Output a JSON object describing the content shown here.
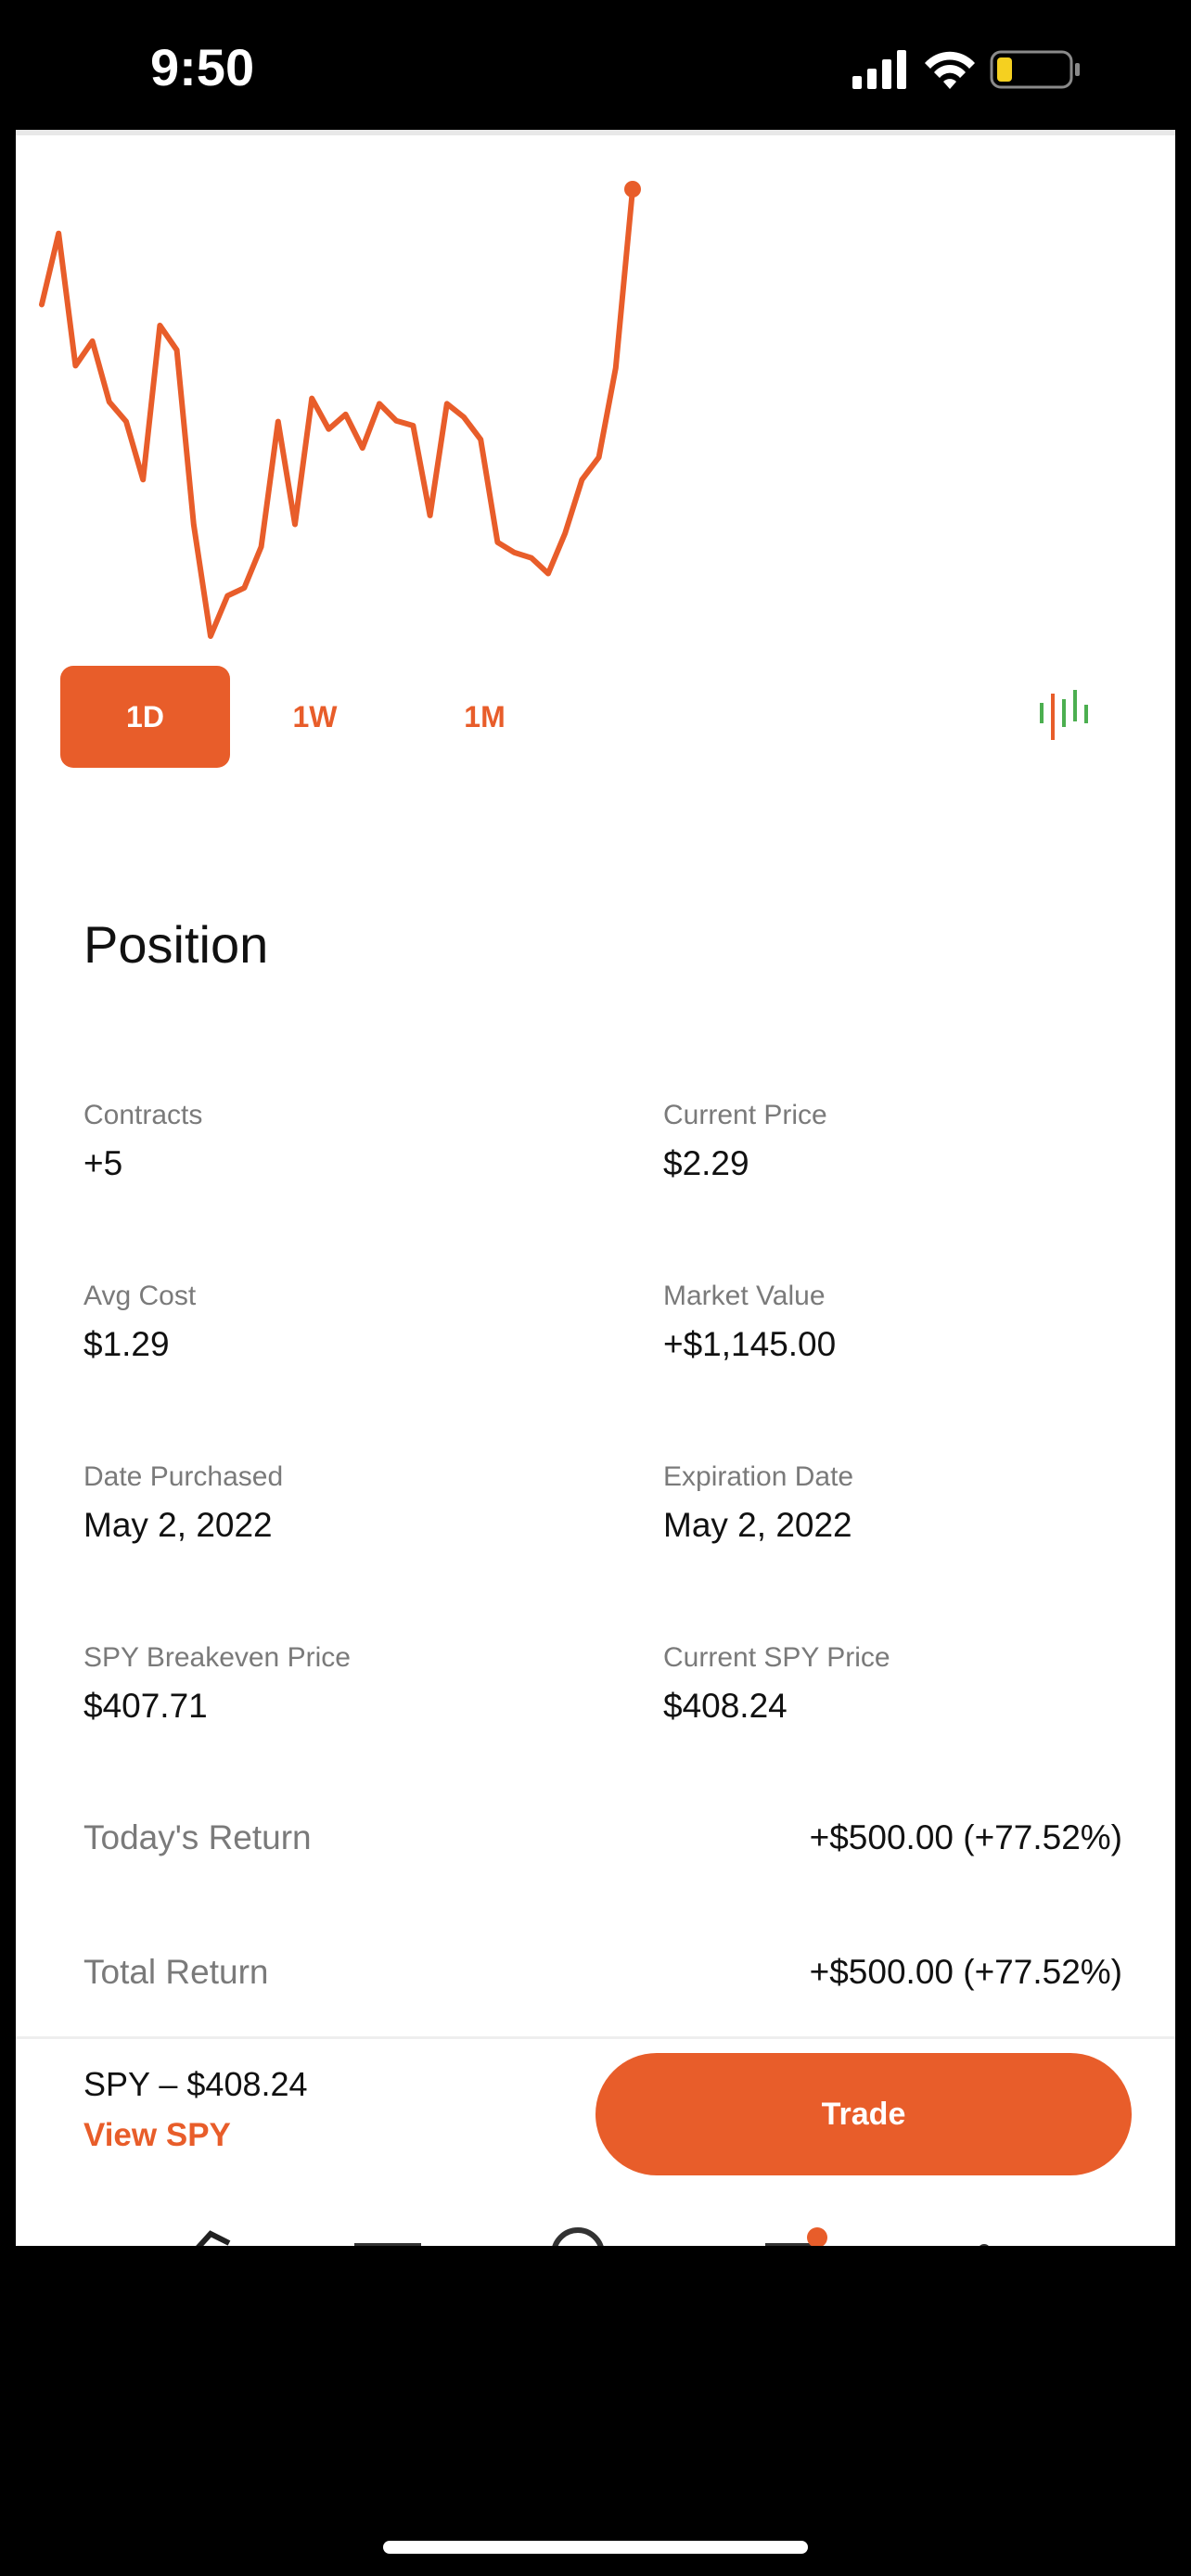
{
  "status_bar": {
    "time": "9:50",
    "icons": [
      "signal-icon",
      "wifi-icon",
      "battery-icon"
    ]
  },
  "chart": {
    "color": "#e85d2a",
    "points": [
      0.742,
      0.901,
      0.605,
      0.66,
      0.524,
      0.48,
      0.35,
      0.695,
      0.64,
      0.25,
      0.0,
      0.09,
      0.108,
      0.2,
      0.48,
      0.25,
      0.532,
      0.463,
      0.496,
      0.421,
      0.52,
      0.482,
      0.471,
      0.27,
      0.52,
      0.49,
      0.44,
      0.21,
      0.187,
      0.175,
      0.14,
      0.23,
      0.35,
      0.4,
      0.6,
      1.0
    ],
    "ranges": [
      "1D",
      "1W",
      "1M"
    ],
    "active_range": "1D"
  },
  "position": {
    "title": "Position",
    "stats": [
      {
        "label": "Contracts",
        "value": "+5"
      },
      {
        "label": "Current Price",
        "value": "$2.29"
      },
      {
        "label": "Avg Cost",
        "value": "$1.29"
      },
      {
        "label": "Market Value",
        "value": "+$1,145.00"
      },
      {
        "label": "Date Purchased",
        "value": "May 2, 2022"
      },
      {
        "label": "Expiration Date",
        "value": "May 2, 2022"
      },
      {
        "label": "SPY Breakeven Price",
        "value": "$407.71"
      },
      {
        "label": "Current SPY Price",
        "value": "$408.24"
      }
    ],
    "returns": [
      {
        "label": "Today's Return",
        "value": "+$500.00 (+77.52%)"
      },
      {
        "label": "Total Return",
        "value": "+$500.00 (+77.52%)"
      }
    ]
  },
  "bottom_bar": {
    "ticker": "SPY – $408.24",
    "view_link": "View SPY",
    "trade_label": "Trade"
  },
  "colors": {
    "accent": "#e85d2a",
    "candle_green": "#4caf50",
    "candle_red": "#e85d2a"
  }
}
